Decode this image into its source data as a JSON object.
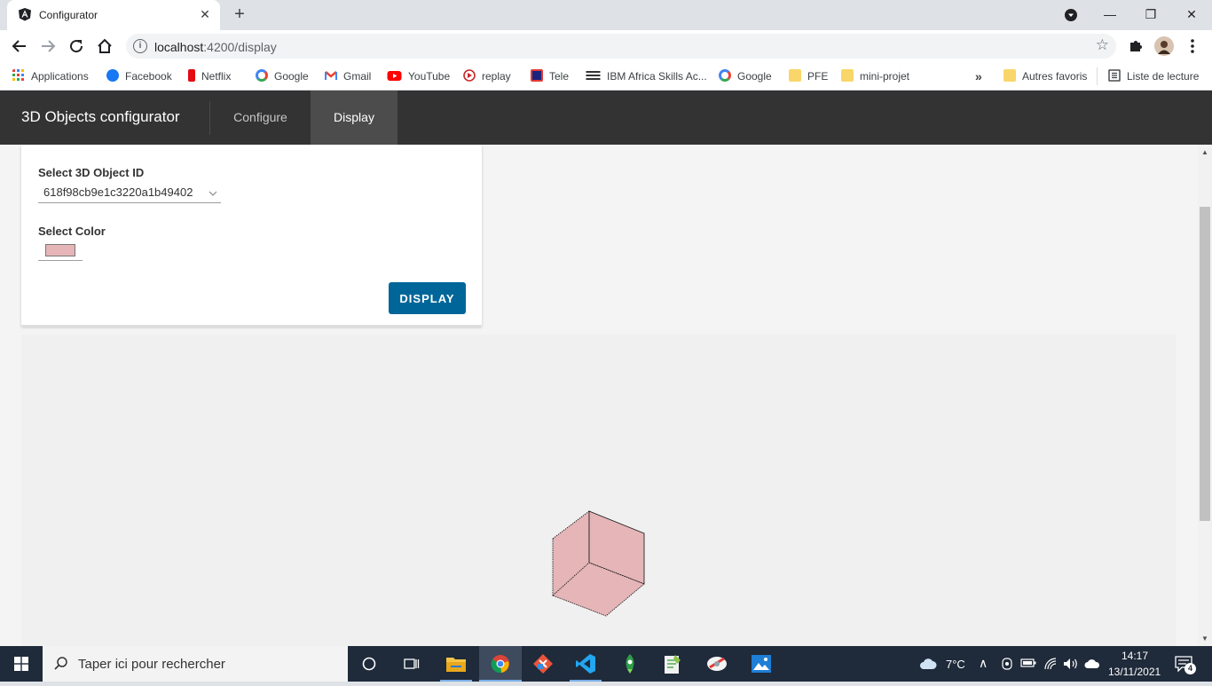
{
  "browser": {
    "tab_title": "Configurator",
    "tab_close": "✕",
    "new_tab": "+",
    "url_host": "localhost",
    "url_path": ":4200/display",
    "window_buttons": {
      "minimize": "—",
      "maximize": "❐",
      "close": "✕"
    }
  },
  "bookmarks": [
    {
      "label": "Applications",
      "icon": "apps-grid-icon",
      "color": "#ea4335"
    },
    {
      "label": "Facebook",
      "icon": "facebook-icon",
      "color": "#1877f2"
    },
    {
      "label": "Netflix",
      "icon": "netflix-icon",
      "color": "#e50914"
    },
    {
      "label": "Google",
      "icon": "google-icon",
      "color": "#4285f4"
    },
    {
      "label": "Gmail",
      "icon": "gmail-icon",
      "color": "#ea4335"
    },
    {
      "label": "YouTube",
      "icon": "youtube-icon",
      "color": "#ff0000"
    },
    {
      "label": "replay",
      "icon": "replay-icon",
      "color": "#c62828"
    },
    {
      "label": "Tele",
      "icon": "tele-icon",
      "color": "#1a237e"
    },
    {
      "label": "IBM Africa Skills Ac...",
      "icon": "ibm-icon",
      "color": "#333333"
    },
    {
      "label": "Google",
      "icon": "google-icon",
      "color": "#4285f4"
    },
    {
      "label": "PFE",
      "icon": "folder-icon",
      "color": "#f9d66a"
    },
    {
      "label": "mini-projet",
      "icon": "folder-icon",
      "color": "#f9d66a"
    }
  ],
  "bookmarks_more": "»",
  "bookmarks_right": [
    {
      "label": "Autres favoris",
      "icon": "folder-icon"
    },
    {
      "label": "Liste de lecture",
      "icon": "reading-list-icon"
    }
  ],
  "app": {
    "brand": "3D Objects configurator",
    "nav": [
      {
        "label": "Configure",
        "active": false
      },
      {
        "label": "Display",
        "active": true
      }
    ]
  },
  "form": {
    "object_id_label": "Select 3D Object ID",
    "object_id_value": "618f98cb9e1c3220a1b49402",
    "color_label": "Select Color",
    "color_value": "#e5b5b8",
    "display_button": "DISPLAY"
  },
  "viewer": {
    "object_color": "#e5b5b8"
  },
  "taskbar": {
    "search_placeholder": "Taper ici pour rechercher",
    "temperature": "7°C",
    "time": "14:17",
    "date": "13/11/2021",
    "notification_count": "4"
  }
}
